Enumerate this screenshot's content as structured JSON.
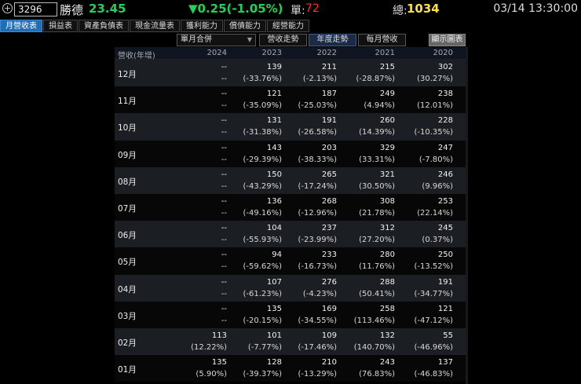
{
  "quote": {
    "code": "3296",
    "name": "勝德",
    "price": "23.45",
    "change": "▼0.25(-1.05%)",
    "lots_label": "單:",
    "lots": "72",
    "total_label": "總:",
    "total": "1034",
    "time": "03/14 13:30:00"
  },
  "tabs": [
    "月營收表",
    "損益表",
    "資產負債表",
    "現金流量表",
    "獲利能力",
    "償債能力",
    "經營能力"
  ],
  "controls": {
    "select_value": "單月合併",
    "btn_trend": "營收走勢",
    "btn_yearly": "年度走勢",
    "btn_monthly": "每月營收",
    "btn_show_chart": "顯示圖表"
  },
  "table": {
    "header_label": "營收(年增)",
    "years": [
      "2024",
      "2023",
      "2022",
      "2021",
      "2020"
    ],
    "rows": [
      {
        "month": "12月",
        "cells": [
          [
            "--",
            "--"
          ],
          [
            "139",
            "(-33.76%)"
          ],
          [
            "211",
            "(-2.13%)"
          ],
          [
            "215",
            "(-28.87%)"
          ],
          [
            "302",
            "(30.27%)"
          ]
        ]
      },
      {
        "month": "11月",
        "cells": [
          [
            "--",
            "--"
          ],
          [
            "121",
            "(-35.09%)"
          ],
          [
            "187",
            "(-25.03%)"
          ],
          [
            "249",
            "(4.94%)"
          ],
          [
            "238",
            "(12.01%)"
          ]
        ]
      },
      {
        "month": "10月",
        "cells": [
          [
            "--",
            "--"
          ],
          [
            "131",
            "(-31.38%)"
          ],
          [
            "191",
            "(-26.58%)"
          ],
          [
            "260",
            "(14.39%)"
          ],
          [
            "228",
            "(-10.35%)"
          ]
        ]
      },
      {
        "month": "09月",
        "cells": [
          [
            "--",
            "--"
          ],
          [
            "143",
            "(-29.39%)"
          ],
          [
            "203",
            "(-38.33%)"
          ],
          [
            "329",
            "(33.31%)"
          ],
          [
            "247",
            "(-7.80%)"
          ]
        ]
      },
      {
        "month": "08月",
        "cells": [
          [
            "--",
            "--"
          ],
          [
            "150",
            "(-43.29%)"
          ],
          [
            "265",
            "(-17.24%)"
          ],
          [
            "321",
            "(30.50%)"
          ],
          [
            "246",
            "(9.96%)"
          ]
        ]
      },
      {
        "month": "07月",
        "cells": [
          [
            "--",
            "--"
          ],
          [
            "136",
            "(-49.16%)"
          ],
          [
            "268",
            "(-12.96%)"
          ],
          [
            "308",
            "(21.78%)"
          ],
          [
            "253",
            "(22.14%)"
          ]
        ]
      },
      {
        "month": "06月",
        "cells": [
          [
            "--",
            "--"
          ],
          [
            "104",
            "(-55.93%)"
          ],
          [
            "237",
            "(-23.99%)"
          ],
          [
            "312",
            "(27.20%)"
          ],
          [
            "245",
            "(0.37%)"
          ]
        ]
      },
      {
        "month": "05月",
        "cells": [
          [
            "--",
            "--"
          ],
          [
            "94",
            "(-59.62%)"
          ],
          [
            "233",
            "(-16.73%)"
          ],
          [
            "280",
            "(11.76%)"
          ],
          [
            "250",
            "(-13.52%)"
          ]
        ]
      },
      {
        "month": "04月",
        "cells": [
          [
            "--",
            "--"
          ],
          [
            "107",
            "(-61.23%)"
          ],
          [
            "276",
            "(-4.23%)"
          ],
          [
            "288",
            "(50.41%)"
          ],
          [
            "191",
            "(-34.77%)"
          ]
        ]
      },
      {
        "month": "03月",
        "cells": [
          [
            "--",
            "--"
          ],
          [
            "135",
            "(-20.15%)"
          ],
          [
            "169",
            "(-34.55%)"
          ],
          [
            "258",
            "(113.46%)"
          ],
          [
            "121",
            "(-47.12%)"
          ]
        ]
      },
      {
        "month": "02月",
        "cells": [
          [
            "113",
            "(12.22%)"
          ],
          [
            "101",
            "(-7.77%)"
          ],
          [
            "109",
            "(-17.46%)"
          ],
          [
            "132",
            "(140.70%)"
          ],
          [
            "55",
            "(-46.96%)"
          ]
        ]
      },
      {
        "month": "01月",
        "cells": [
          [
            "135",
            "(5.90%)"
          ],
          [
            "128",
            "(-39.37%)"
          ],
          [
            "210",
            "(-13.29%)"
          ],
          [
            "243",
            "(76.83%)"
          ],
          [
            "137",
            "(-46.83%)"
          ]
        ]
      }
    ]
  },
  "colors": {
    "up": "#22d05a",
    "down_lots": "#ff3030",
    "total": "#ffe135",
    "active_tab": "#1f6fb8"
  }
}
